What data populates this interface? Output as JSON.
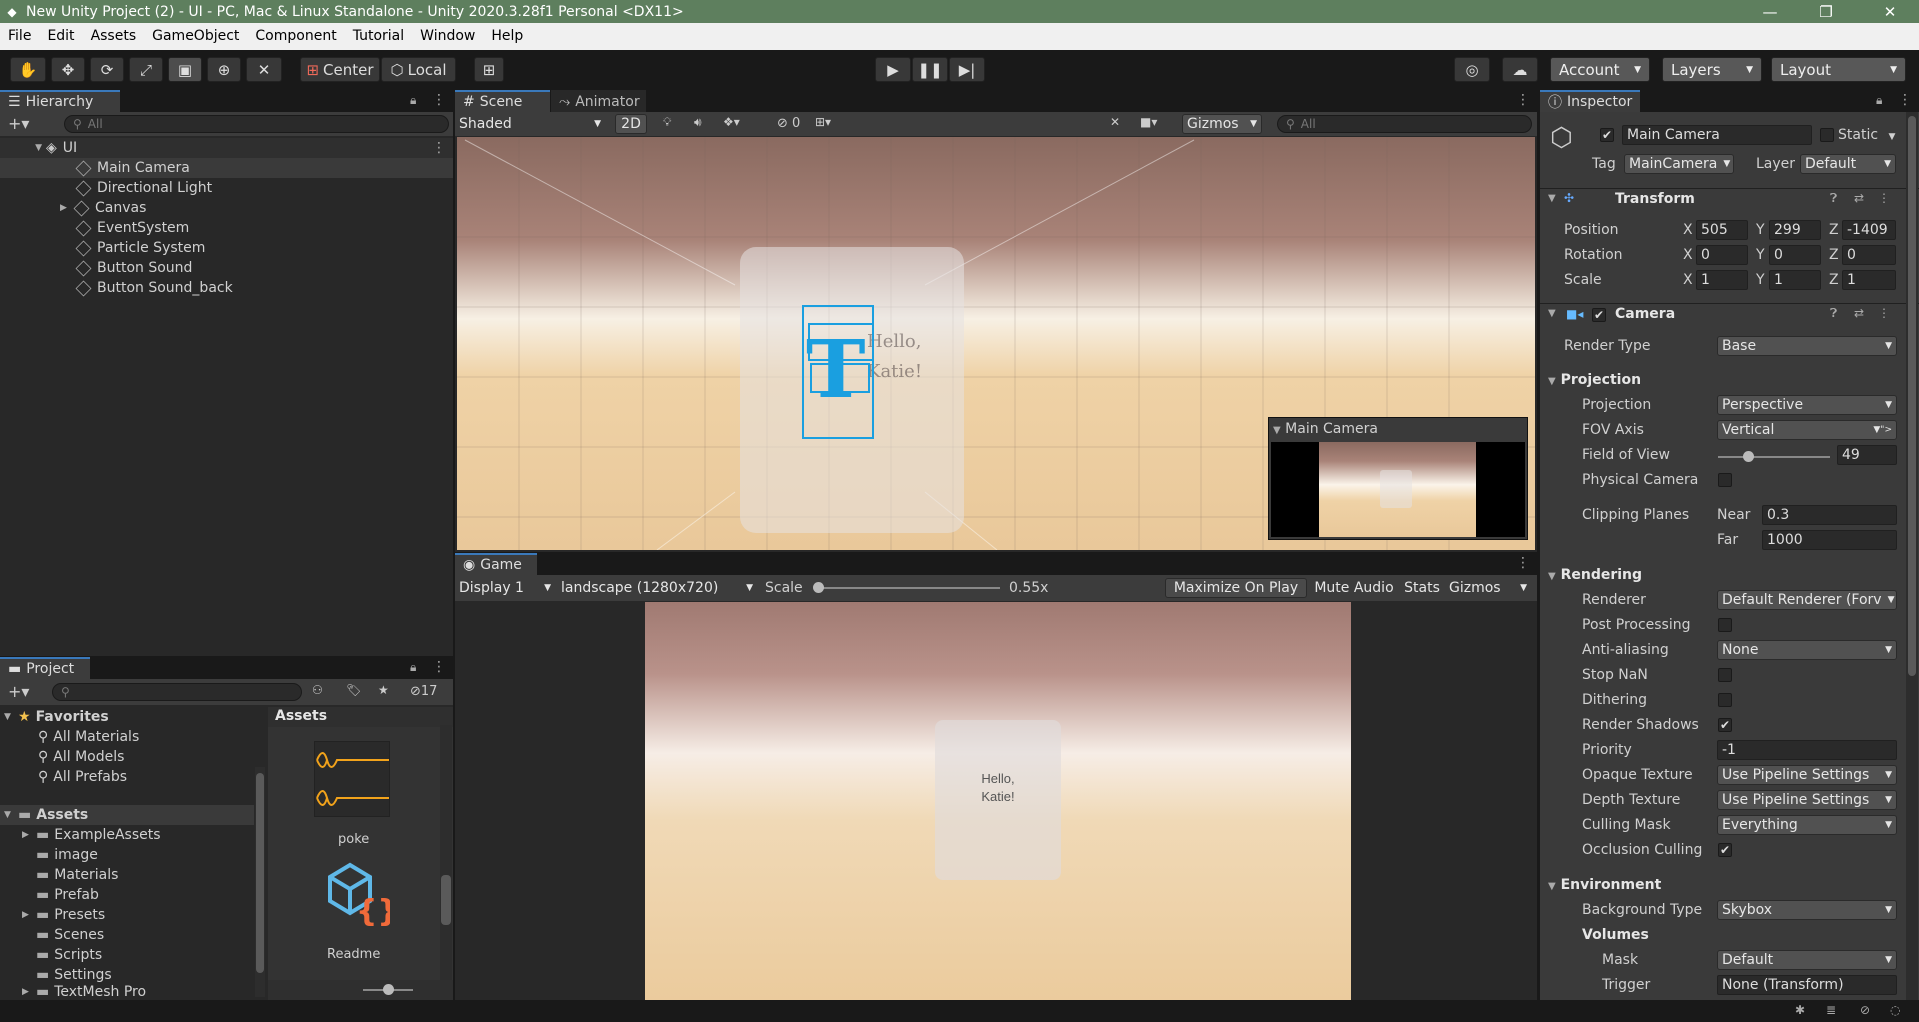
{
  "window": {
    "title": "New Unity Project (2) - UI - PC, Mac & Linux Standalone - Unity 2020.3.28f1 Personal <DX11>"
  },
  "menu": [
    "File",
    "Edit",
    "Assets",
    "GameObject",
    "Component",
    "Tutorial",
    "Window",
    "Help"
  ],
  "toolbar": {
    "center_label": "Center",
    "local_label": "Local",
    "account_label": "Account",
    "layers_label": "Layers",
    "layout_label": "Layout"
  },
  "hierarchy": {
    "tab": "Hierarchy",
    "search_placeholder": "All",
    "scene": "UI",
    "items": [
      "Main Camera",
      "Directional Light",
      "Canvas",
      "EventSystem",
      "Particle System",
      "Button Sound",
      "Button Sound_back"
    ]
  },
  "scene_view": {
    "tabs": [
      "Scene",
      "Animator"
    ],
    "shading": "Shaded",
    "mode_2d": "2D",
    "hidden_count": "0",
    "gizmos": "Gizmos",
    "search_placeholder": "All",
    "preview_title": "Main Camera"
  },
  "game_view": {
    "tab": "Game",
    "display": "Display 1",
    "resolution": "landscape (1280x720)",
    "scale_label": "Scale",
    "scale_value": "0.55x",
    "maximize": "Maximize On Play",
    "mute": "Mute Audio",
    "stats": "Stats",
    "gizmos": "Gizmos",
    "card_text_line1": "Hello,",
    "card_text_line2": "Katie!"
  },
  "project": {
    "tab": "Project",
    "hidden_count": "17",
    "favorites_label": "Favorites",
    "favorites": [
      "All Materials",
      "All Models",
      "All Prefabs"
    ],
    "assets_label": "Assets",
    "folders": [
      "ExampleAssets",
      "image",
      "Materials",
      "Prefab",
      "Presets",
      "Scenes",
      "Scripts",
      "Settings",
      "TextMesh Pro"
    ],
    "breadcrumb": "Assets",
    "files": [
      "poke",
      "Readme"
    ]
  },
  "inspector": {
    "tab": "Inspector",
    "object_name": "Main Camera",
    "static_label": "Static",
    "tag_label": "Tag",
    "tag_value": "MainCamera",
    "layer_label": "Layer",
    "layer_value": "Default",
    "transform": {
      "title": "Transform",
      "position_label": "Position",
      "pos_x": "505",
      "pos_y": "299",
      "pos_z": "-1409",
      "rotation_label": "Rotation",
      "rot_x": "0",
      "rot_y": "0",
      "rot_z": "0",
      "scale_label": "Scale",
      "scl_x": "1",
      "scl_y": "1",
      "scl_z": "1",
      "x": "X",
      "y": "Y",
      "z": "Z"
    },
    "camera": {
      "title": "Camera",
      "render_type_label": "Render Type",
      "render_type": "Base",
      "projection_header": "Projection",
      "projection_label": "Projection",
      "projection": "Perspective",
      "fov_axis_label": "FOV Axis",
      "fov_axis": "Vertical",
      "fov_label": "Field of View",
      "fov": "49",
      "fov_fraction": 0.27,
      "physical_label": "Physical Camera",
      "clipping_label": "Clipping Planes",
      "near_label": "Near",
      "near": "0.3",
      "far_label": "Far",
      "far": "1000",
      "rendering_header": "Rendering",
      "renderer_label": "Renderer",
      "renderer": "Default Renderer (Forv",
      "post_label": "Post Processing",
      "aa_label": "Anti-aliasing",
      "aa": "None",
      "stopnan_label": "Stop NaN",
      "dither_label": "Dithering",
      "shadows_label": "Render Shadows",
      "priority_label": "Priority",
      "priority": "-1",
      "opaque_label": "Opaque Texture",
      "opaque": "Use Pipeline Settings",
      "depth_label": "Depth Texture",
      "depth": "Use Pipeline Settings",
      "culling_label": "Culling Mask",
      "culling": "Everything",
      "occlusion_label": "Occlusion Culling",
      "environment_header": "Environment",
      "bg_label": "Background Type",
      "bg": "Skybox",
      "volumes_label": "Volumes",
      "mask_label": "Mask",
      "mask": "Default",
      "trigger_label": "Trigger",
      "trigger": "None (Transform)"
    }
  }
}
